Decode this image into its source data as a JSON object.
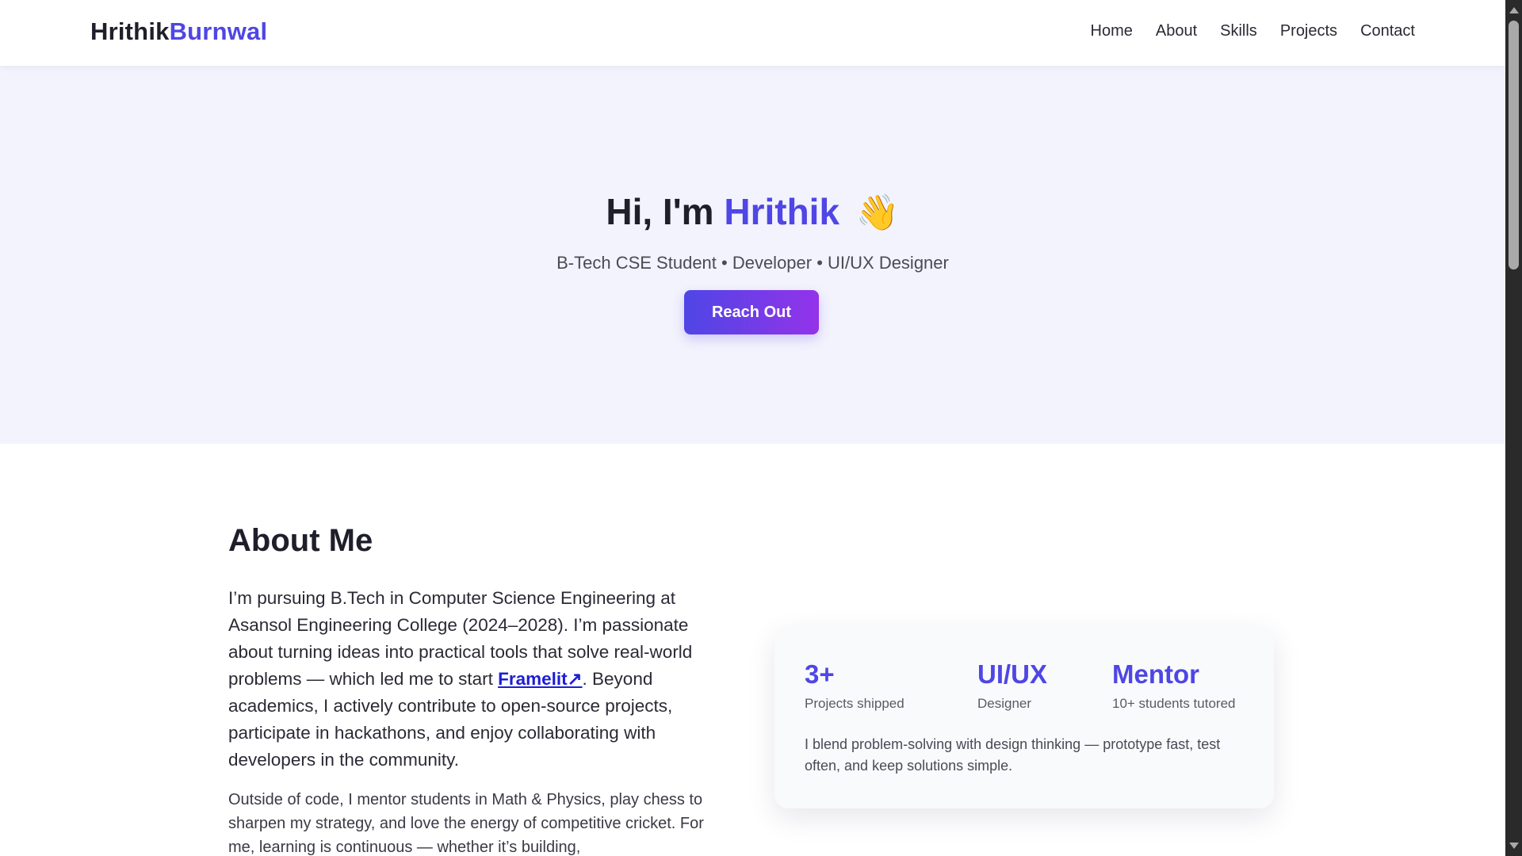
{
  "header": {
    "logo_first": "Hrithik",
    "logo_second": "Burnwal",
    "nav": [
      "Home",
      "About",
      "Skills",
      "Projects",
      "Contact"
    ]
  },
  "hero": {
    "greeting": "Hi, I'm",
    "name": "Hrithik",
    "wave_emoji": "👋",
    "subtitle": "B-Tech CSE Student • Developer • UI/UX Designer",
    "cta": "Reach Out"
  },
  "about": {
    "title": "About Me",
    "p1_before": "I’m pursuing B.Tech in Computer Science Engineering at Asansol Engineering College (2024–2028). I’m passionate about turning ideas into practical tools that solve real-world problems — which led me to start ",
    "p1_link": "Framelit↗",
    "p1_after": ". Beyond academics, I actively contribute to open-source projects, participate in hackathons, and enjoy collaborating with developers in the community.",
    "p2": "Outside of code, I mentor students in Math & Physics, play chess to sharpen my strategy, and love the energy of competitive cricket. For me, learning is continuous — whether it’s building,",
    "stats": [
      {
        "value": "3+",
        "label": "Projects shipped"
      },
      {
        "value": "UI/UX",
        "label": "Designer"
      },
      {
        "value": "Mentor",
        "label": "10+ students tutored"
      }
    ],
    "card_note": "I blend problem-solving with design thinking — prototype fast, test often, and keep solutions simple."
  },
  "colors": {
    "accent": "#4f46e5",
    "hero_bg": "#f2f3fd",
    "button_gradient": [
      "#4f46e5",
      "#9333ea"
    ]
  }
}
